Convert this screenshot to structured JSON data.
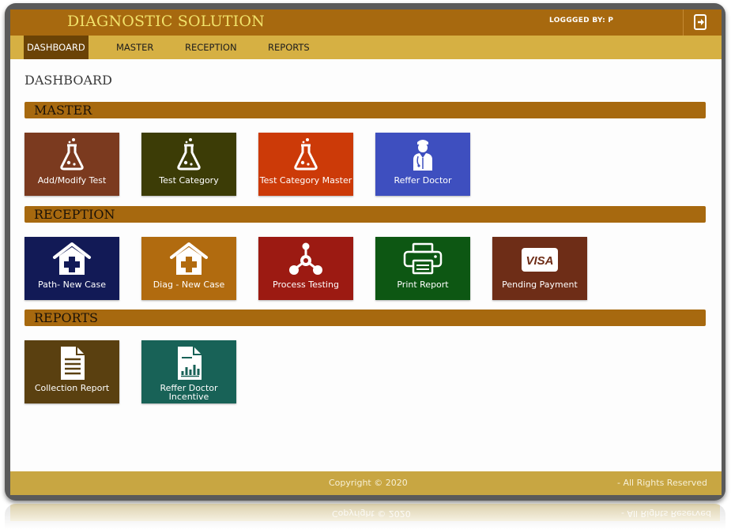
{
  "header": {
    "title": "DIAGNOSTIC SOLUTION",
    "logged_by": "LOGGGED BY: P",
    "logout_icon": "logout-icon"
  },
  "menu": [
    {
      "label": "DASHBOARD",
      "active": true
    },
    {
      "label": "MASTER",
      "active": false
    },
    {
      "label": "RECEPTION",
      "active": false
    },
    {
      "label": "REPORTS",
      "active": false
    }
  ],
  "page_title": "DASHBOARD",
  "sections": {
    "master": {
      "title": "MASTER",
      "tiles": [
        {
          "label": "Add/Modify Test",
          "icon": "flask-icon",
          "color": "#7b3a1f"
        },
        {
          "label": "Test Category",
          "icon": "flask-icon",
          "color": "#3c3c06"
        },
        {
          "label": "Test Category Master",
          "icon": "flask-icon",
          "color": "#cc3a08"
        },
        {
          "label": "Reffer Doctor",
          "icon": "doctor-icon",
          "color": "#3e4fbf"
        }
      ]
    },
    "reception": {
      "title": "RECEPTION",
      "tiles": [
        {
          "label": "Path- New Case",
          "icon": "hospital-icon",
          "color": "#121a56"
        },
        {
          "label": "Diag - New Case",
          "icon": "hospital-icon",
          "color": "#b16b0f"
        },
        {
          "label": "Process Testing",
          "icon": "process-icon",
          "color": "#9c1a12"
        },
        {
          "label": "Print Report",
          "icon": "printer-icon",
          "color": "#0d5713"
        },
        {
          "label": "Pending Payment",
          "icon": "visa-card-icon",
          "color": "#6e2d17"
        }
      ]
    },
    "reports": {
      "title": "REPORTS",
      "tiles": [
        {
          "label": "Collection Report",
          "icon": "document-icon",
          "color": "#5a4010"
        },
        {
          "label": "Reffer Doctor Incentive",
          "icon": "report-chart-icon",
          "color": "#186257"
        }
      ]
    }
  },
  "footer": {
    "copyright": "Copyright © 2020",
    "rights": "- All Rights Reserved"
  },
  "colors": {
    "header_bg": "#a7690f",
    "menu_bg": "#d6b043",
    "brand_text": "#f1e26a",
    "footer_bg": "#c8a642"
  }
}
